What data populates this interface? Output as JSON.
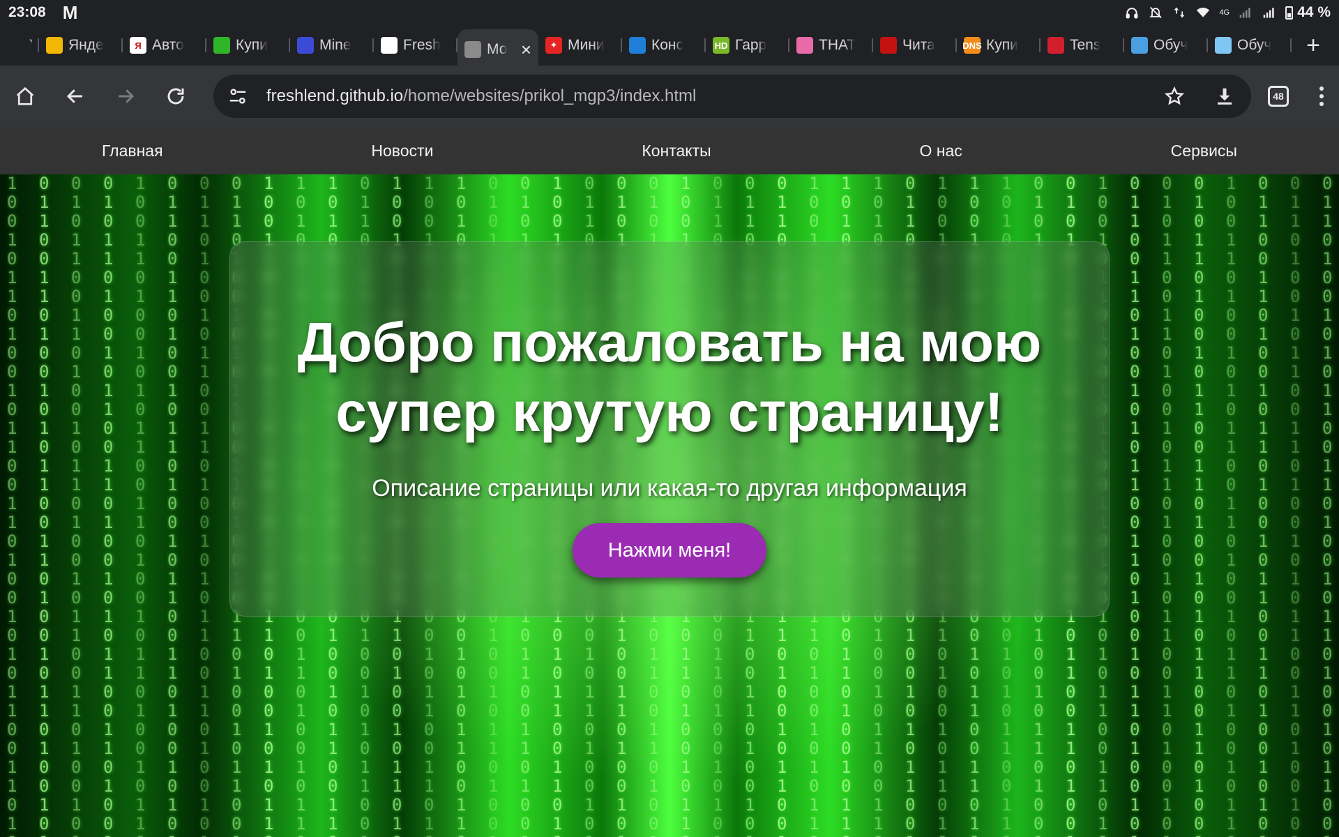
{
  "status_bar": {
    "time": "23:08",
    "app_icon": "M",
    "battery": "44 %",
    "network": "4G"
  },
  "tabs": [
    {
      "label": "YCh",
      "favicon_color": "#202124",
      "favicon_text": "",
      "partial": true
    },
    {
      "label": "Янде",
      "favicon_color": "#f2b705",
      "favicon_text": ""
    },
    {
      "label": "Авто",
      "favicon_color": "#fff",
      "favicon_text": "Я"
    },
    {
      "label": "Купи",
      "favicon_color": "#2fb52a",
      "favicon_text": ""
    },
    {
      "label": "Mine",
      "favicon_color": "#3c4bd6",
      "favicon_text": ""
    },
    {
      "label": "Fresh",
      "favicon_color": "#fff",
      "favicon_text": ""
    },
    {
      "label": "Мо",
      "favicon_color": "#8a8a8a",
      "favicon_text": "",
      "active": true
    },
    {
      "label": "Мини",
      "favicon_color": "#e52424",
      "favicon_text": "✦"
    },
    {
      "label": "Конс",
      "favicon_color": "#1f7ed8",
      "favicon_text": ""
    },
    {
      "label": "Гарр",
      "favicon_color": "#7ab82a",
      "favicon_text": "HD"
    },
    {
      "label": "THAT",
      "favicon_color": "#e86aa8",
      "favicon_text": ""
    },
    {
      "label": "Чита",
      "favicon_color": "#c41212",
      "favicon_text": ""
    },
    {
      "label": "Купи",
      "favicon_color": "#f28c1b",
      "favicon_text": "DNS"
    },
    {
      "label": "Tens",
      "favicon_color": "#d11f2e",
      "favicon_text": ""
    },
    {
      "label": "Обуч",
      "favicon_color": "#4a9fe0",
      "favicon_text": ""
    },
    {
      "label": "Обуч",
      "favicon_color": "#7fc7f2",
      "favicon_text": ""
    },
    {
      "label": "",
      "favicon_color": "#202124",
      "favicon_text": "",
      "partial": true
    }
  ],
  "toolbar": {
    "url_host": "freshlend.github.io",
    "url_path": "/home/websites/prikol_mgp3/index.html",
    "tab_count": "48"
  },
  "site": {
    "nav": [
      "Главная",
      "Новости",
      "Контакты",
      "О нас",
      "Сервисы"
    ],
    "hero_title": "Добро пожаловать на мою супер крутую страницу!",
    "hero_subtitle": "Описание страницы или какая-то другая информация",
    "hero_button": "Нажми меня!"
  },
  "colors": {
    "accent_button": "#9b2bb3",
    "matrix_green": "#3aff2a",
    "nav_bg": "#333333"
  },
  "icons": {
    "home": "home-icon",
    "back": "back-arrow-icon",
    "forward": "forward-arrow-icon",
    "reload": "reload-icon",
    "site_info": "site-info-icon",
    "bookmark": "star-icon",
    "download": "download-icon",
    "menu": "menu-dots-icon"
  }
}
